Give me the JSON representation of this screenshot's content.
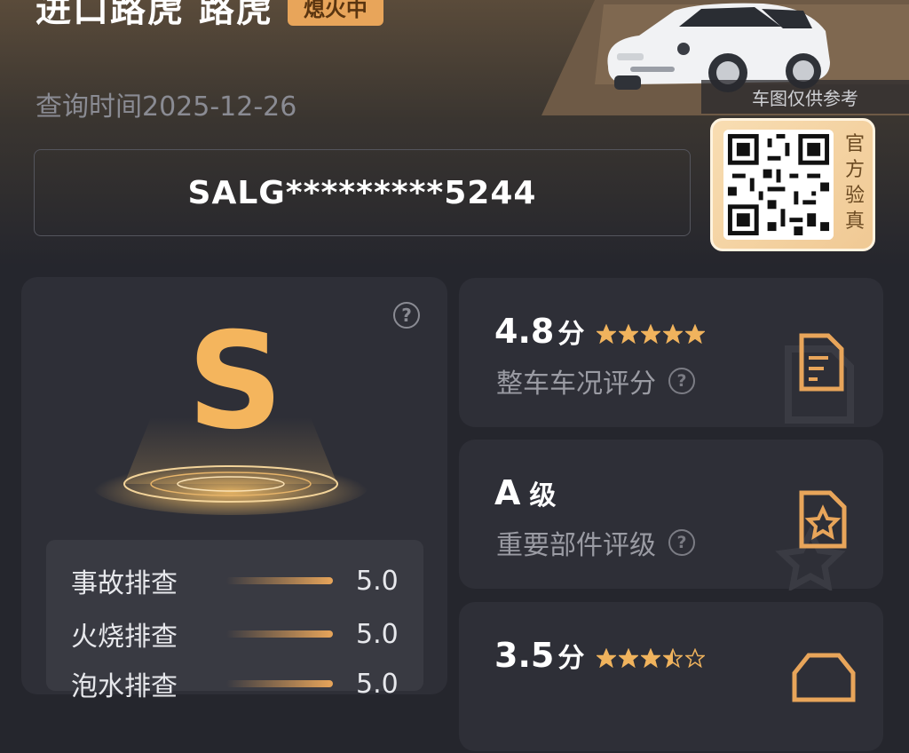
{
  "header": {
    "title": "进口路虎 路虎",
    "badge": "熄火中",
    "query_time": "查询时间2025-12-26",
    "vin": "SALG*********5244"
  },
  "car_image": {
    "note": "车图仅供参考"
  },
  "verify": {
    "label": [
      "官",
      "方",
      "验",
      "真"
    ]
  },
  "grade": {
    "letter": "S",
    "help": "?",
    "rows": [
      {
        "label": "事故排查",
        "value": "5.0"
      },
      {
        "label": "火烧排查",
        "value": "5.0"
      },
      {
        "label": "泡水排查",
        "value": "5.0"
      }
    ]
  },
  "cards": [
    {
      "value": "4.8",
      "unit": "分",
      "stars": 5,
      "label": "整车车况评分",
      "icon": "document-edit-icon"
    },
    {
      "value": "A",
      "unit": "级",
      "stars": 0,
      "label": "重要部件评级",
      "icon": "star-file-icon"
    },
    {
      "value": "3.5",
      "unit": "分",
      "stars": 3.5,
      "label": "",
      "icon": "car-front-icon"
    }
  ],
  "colors": {
    "accent": "#e8a55a",
    "grade": "#f4b55d",
    "card": "#2e2f37",
    "bg": "#25262d"
  }
}
